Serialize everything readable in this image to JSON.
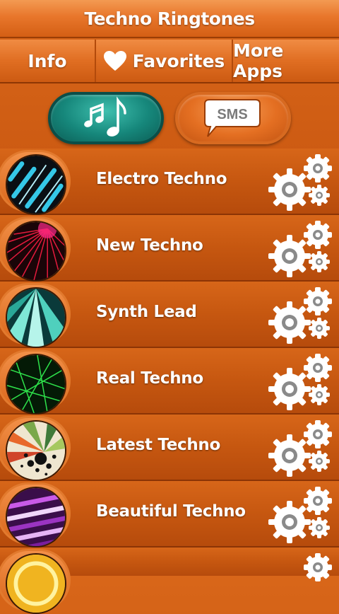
{
  "app": {
    "title": "Techno Ringtones"
  },
  "nav": {
    "info_label": "Info",
    "favorites_label": "Favorites",
    "more_apps_label": "More Apps",
    "favorites_icon": "heart-icon"
  },
  "modes": {
    "ringtones_icon": "music-notes-icon",
    "sms_label": "SMS",
    "ringtones_color": "#16877b",
    "sms_color": "#e46f22"
  },
  "list": {
    "items": [
      {
        "label": "Electro Techno",
        "icon": "electro-thumbnail"
      },
      {
        "label": "New Techno",
        "icon": "laser-thumbnail"
      },
      {
        "label": "Synth Lead",
        "icon": "beams-thumbnail"
      },
      {
        "label": "Real Techno",
        "icon": "grid-thumbnail"
      },
      {
        "label": "Latest Techno",
        "icon": "burst-thumbnail"
      },
      {
        "label": "Beautiful Techno",
        "icon": "stripes-thumbnail"
      }
    ],
    "settings_icon": "gears-icon"
  },
  "colors": {
    "accent": "#e8762b",
    "teal": "#16877b"
  }
}
